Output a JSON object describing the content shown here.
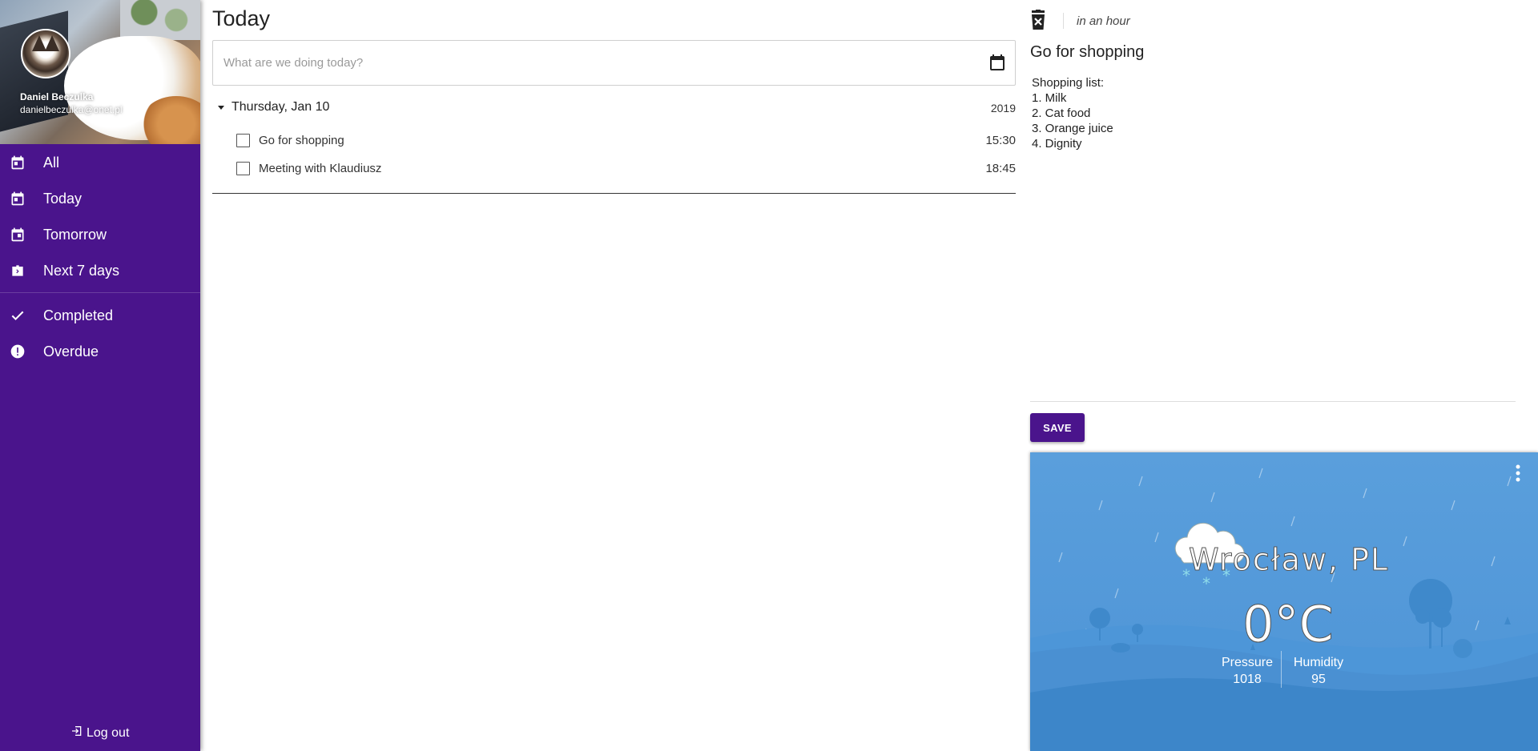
{
  "sidebar": {
    "user": {
      "name": "Daniel Beczulka",
      "email": "danielbeczulka@onet.pl"
    },
    "items": [
      {
        "label": "All",
        "icon": "calendar-icon"
      },
      {
        "label": "Today",
        "icon": "calendar-today-icon"
      },
      {
        "label": "Tomorrow",
        "icon": "calendar-tomorrow-icon"
      },
      {
        "label": "Next 7 days",
        "icon": "calendar-week-icon"
      },
      {
        "label": "Completed",
        "icon": "check-icon"
      },
      {
        "label": "Overdue",
        "icon": "alert-circle-icon"
      }
    ],
    "logout_label": "Log out"
  },
  "main": {
    "title": "Today",
    "input": {
      "placeholder": "What are we doing today?",
      "value": ""
    },
    "day": {
      "label": "Thursday, Jan 10",
      "year": "2019"
    },
    "tasks": [
      {
        "title": "Go for shopping",
        "time": "15:30",
        "completed": false
      },
      {
        "title": "Meeting with Klaudiusz",
        "time": "18:45",
        "completed": false
      }
    ]
  },
  "detail": {
    "due": "in an hour",
    "title": "Go for shopping",
    "notes": [
      "Shopping list:",
      "1. Milk",
      "2. Cat food",
      "3. Orange juice",
      "4. Dignity"
    ],
    "save_label": "SAVE"
  },
  "weather": {
    "city": "Wrocław, PL",
    "temperature": "0°C",
    "pressure_label": "Pressure",
    "pressure_value": "1018",
    "humidity_label": "Humidity",
    "humidity_value": "95",
    "condition_icon": "cloud-snow-icon"
  },
  "colors": {
    "brand": "#4a148c",
    "weather_sky": "#5a9fdc",
    "weather_hill": "#3d86c9"
  }
}
